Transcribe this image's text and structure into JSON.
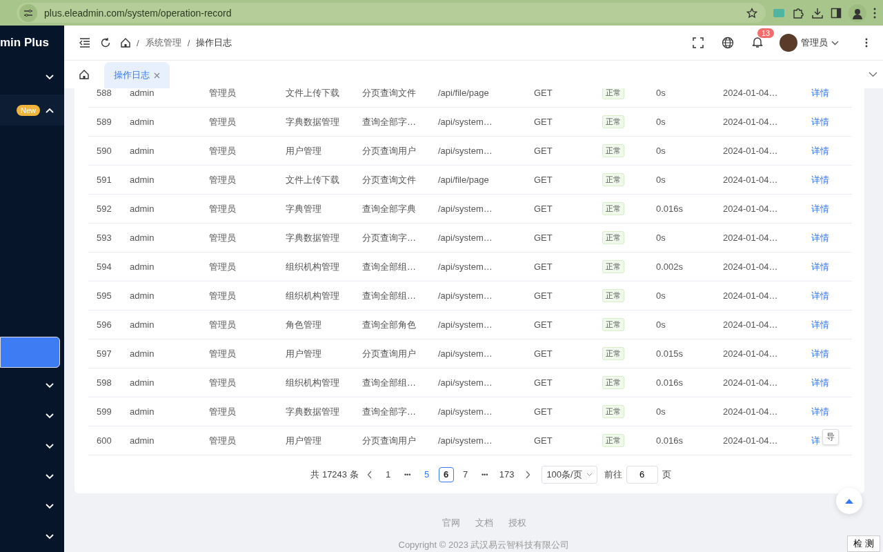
{
  "browser": {
    "url": "plus.eleadmin.com/system/operation-record"
  },
  "sidebar": {
    "title": "min Plus",
    "items": [
      {
        "kind": "submenu",
        "expanded": false,
        "selected": false
      },
      {
        "kind": "submenu",
        "badge": "New",
        "expanded": true,
        "selected": false
      },
      {
        "kind": "item",
        "selected": true
      },
      {
        "kind": "submenu",
        "expanded": false,
        "selected": false
      },
      {
        "kind": "submenu",
        "expanded": false,
        "selected": false
      },
      {
        "kind": "submenu",
        "expanded": false,
        "selected": false
      },
      {
        "kind": "submenu",
        "expanded": false,
        "selected": false
      },
      {
        "kind": "submenu",
        "expanded": false,
        "selected": false
      },
      {
        "kind": "submenu",
        "expanded": false,
        "selected": false
      }
    ]
  },
  "header": {
    "breadcrumb_separator": "/",
    "breadcrumb": [
      "系统管理",
      "操作日志"
    ],
    "notifications": "13",
    "user": "管理员"
  },
  "tabs": [
    {
      "label": "操作日志",
      "selected": true
    }
  ],
  "table": {
    "rows": [
      [
        "588",
        "admin",
        "管理员",
        "文件上传下载",
        "分页查询文件",
        "/api/file/page",
        "GET",
        "正常",
        "0s",
        "2024-01-04…",
        "详情"
      ],
      [
        "589",
        "admin",
        "管理员",
        "字典数据管理",
        "查询全部字…",
        "/api/system…",
        "GET",
        "正常",
        "0s",
        "2024-01-04…",
        "详情"
      ],
      [
        "590",
        "admin",
        "管理员",
        "用户管理",
        "分页查询用户",
        "/api/system…",
        "GET",
        "正常",
        "0s",
        "2024-01-04…",
        "详情"
      ],
      [
        "591",
        "admin",
        "管理员",
        "文件上传下载",
        "分页查询文件",
        "/api/file/page",
        "GET",
        "正常",
        "0s",
        "2024-01-04…",
        "详情"
      ],
      [
        "592",
        "admin",
        "管理员",
        "字典管理",
        "查询全部字典",
        "/api/system…",
        "GET",
        "正常",
        "0.016s",
        "2024-01-04…",
        "详情"
      ],
      [
        "593",
        "admin",
        "管理员",
        "字典数据管理",
        "分页查询字…",
        "/api/system…",
        "GET",
        "正常",
        "0s",
        "2024-01-04…",
        "详情"
      ],
      [
        "594",
        "admin",
        "管理员",
        "组织机构管理",
        "查询全部组…",
        "/api/system…",
        "GET",
        "正常",
        "0.002s",
        "2024-01-04…",
        "详情"
      ],
      [
        "595",
        "admin",
        "管理员",
        "组织机构管理",
        "查询全部组…",
        "/api/system…",
        "GET",
        "正常",
        "0s",
        "2024-01-04…",
        "详情"
      ],
      [
        "596",
        "admin",
        "管理员",
        "角色管理",
        "查询全部角色",
        "/api/system…",
        "GET",
        "正常",
        "0s",
        "2024-01-04…",
        "详情"
      ],
      [
        "597",
        "admin",
        "管理员",
        "用户管理",
        "分页查询用户",
        "/api/system…",
        "GET",
        "正常",
        "0.015s",
        "2024-01-04…",
        "详情"
      ],
      [
        "598",
        "admin",
        "管理员",
        "组织机构管理",
        "查询全部组…",
        "/api/system…",
        "GET",
        "正常",
        "0.016s",
        "2024-01-04…",
        "详情"
      ],
      [
        "599",
        "admin",
        "管理员",
        "字典数据管理",
        "查询全部字…",
        "/api/system…",
        "GET",
        "正常",
        "0s",
        "2024-01-04…",
        "详情"
      ],
      [
        "600",
        "admin",
        "管理员",
        "用户管理",
        "分页查询用户",
        "/api/system…",
        "GET",
        "正常",
        "0.016s",
        "2024-01-04…",
        "详"
      ]
    ]
  },
  "tooltip": "导",
  "pagination": {
    "total": "共 17243 条",
    "pages": [
      {
        "kind": "page",
        "label": "1",
        "selected": false,
        "hovered": false
      },
      {
        "kind": "more",
        "label": "•••",
        "selected": false,
        "hovered": false
      },
      {
        "kind": "page",
        "label": "5",
        "selected": false,
        "hovered": true
      },
      {
        "kind": "page",
        "label": "6",
        "selected": true,
        "hovered": false
      },
      {
        "kind": "page",
        "label": "7",
        "selected": false,
        "hovered": false
      },
      {
        "kind": "more",
        "label": "•••",
        "selected": false,
        "hovered": false
      },
      {
        "kind": "page",
        "label": "173",
        "selected": false,
        "hovered": false
      }
    ],
    "page_size": "100条/页",
    "goto_label": "前往",
    "goto_value": "6",
    "goto_unit": "页"
  },
  "footer": {
    "links": [
      "官网",
      "文档",
      "授权"
    ],
    "copyright": "Copyright © 2023 武汉易云智科技有限公司"
  },
  "detect_button": "检 测"
}
